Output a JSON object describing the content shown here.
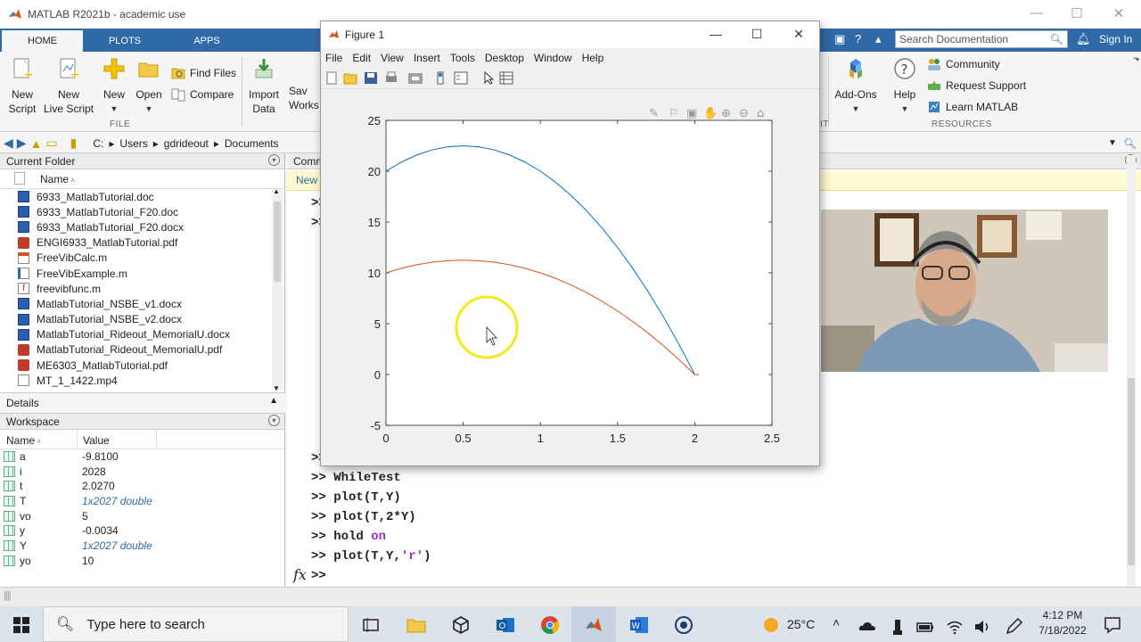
{
  "window": {
    "title": "MATLAB R2021b - academic use",
    "controls": [
      "—",
      "☐",
      "✕"
    ]
  },
  "tabs": [
    "HOME",
    "PLOTS",
    "APPS"
  ],
  "search": {
    "placeholder": "Search Documentation"
  },
  "signin": "Sign In",
  "ribbon": {
    "file": {
      "new_script": [
        "New",
        "Script"
      ],
      "new_live_script": [
        "New",
        "Live Script"
      ],
      "new": "New",
      "open": "Open",
      "find_files": "Find Files",
      "compare": "Compare",
      "label": "FILE"
    },
    "import_data": [
      "Import",
      "Data"
    ],
    "save_workspace": [
      "Sav",
      "Works"
    ],
    "add_ons": "Add-Ons",
    "help": "Help",
    "community": "Community",
    "request_support": "Request Support",
    "learn_matlab": "Learn MATLAB",
    "resources_label": "RESOURCES",
    "env_label_fragment": "IT"
  },
  "address": [
    "C:",
    "Users",
    "gdrideout",
    "Documents"
  ],
  "current_folder": {
    "title": "Current Folder",
    "column": "Name",
    "files": [
      {
        "name": "6933_MatlabTutorial.doc",
        "type": "word"
      },
      {
        "name": "6933_MatlabTutorial_F20.doc",
        "type": "word"
      },
      {
        "name": "6933_MatlabTutorial_F20.docx",
        "type": "word"
      },
      {
        "name": "ENGI6933_MatlabTutorial.pdf",
        "type": "pdf"
      },
      {
        "name": "FreeVibCalc.m",
        "type": "live"
      },
      {
        "name": "FreeVibExample.m",
        "type": "script"
      },
      {
        "name": "freevibfunc.m",
        "type": "func"
      },
      {
        "name": "MatlabTutorial_NSBE_v1.docx",
        "type": "word"
      },
      {
        "name": "MatlabTutorial_NSBE_v2.docx",
        "type": "word"
      },
      {
        "name": "MatlabTutorial_Rideout_MemorialU.docx",
        "type": "word"
      },
      {
        "name": "MatlabTutorial_Rideout_MemorialU.pdf",
        "type": "pdf"
      },
      {
        "name": "ME6303_MatlabTutorial.pdf",
        "type": "pdf"
      },
      {
        "name": "MT_1_1422.mp4",
        "type": "video"
      }
    ]
  },
  "details": {
    "title": "Details"
  },
  "workspace": {
    "title": "Workspace",
    "col_name": "Name",
    "col_value": "Value",
    "vars": [
      {
        "name": "a",
        "value": "-9.8100",
        "italic": false
      },
      {
        "name": "i",
        "value": "2028",
        "italic": false
      },
      {
        "name": "t",
        "value": "2.0270",
        "italic": false
      },
      {
        "name": "T",
        "value": "1x2027 double",
        "italic": true
      },
      {
        "name": "vo",
        "value": "5",
        "italic": false
      },
      {
        "name": "y",
        "value": "-0.0034",
        "italic": false
      },
      {
        "name": "Y",
        "value": "1x2027 double",
        "italic": true
      },
      {
        "name": "yo",
        "value": "10",
        "italic": false
      }
    ]
  },
  "command_window": {
    "title": "Comm",
    "new_link": "New",
    "prompt": ">>",
    "fx": "fx",
    "lines": [
      {
        "prompt": ">>",
        "text": "WhileTest"
      },
      {
        "prompt": ">>",
        "text": "plot(T,Y)"
      },
      {
        "prompt": ">>",
        "text": "plot(T,2*Y)"
      },
      {
        "prompt": ">>",
        "pre": "hold ",
        "kw": "on"
      },
      {
        "prompt": ">>",
        "pre": "plot(T,Y,",
        "str": "'r'",
        "post": ")"
      }
    ]
  },
  "figure": {
    "title": "Figure 1",
    "menu": [
      "File",
      "Edit",
      "View",
      "Insert",
      "Tools",
      "Desktop",
      "Window",
      "Help"
    ]
  },
  "chart_data": {
    "type": "line",
    "title": "",
    "xlabel": "",
    "ylabel": "",
    "xlim": [
      0,
      2.5
    ],
    "ylim": [
      -5,
      25
    ],
    "xticks": [
      "0",
      "0.5",
      "1",
      "1.5",
      "2",
      "2.5"
    ],
    "yticks": [
      "-5",
      "0",
      "5",
      "10",
      "15",
      "20",
      "25"
    ],
    "grid": false,
    "series": [
      {
        "color": "#0072bd",
        "x": [
          0,
          0.1,
          0.2,
          0.3,
          0.4,
          0.5,
          0.6,
          0.7,
          0.8,
          0.9,
          1.0,
          1.1,
          1.2,
          1.3,
          1.4,
          1.5,
          1.6,
          1.7,
          1.8,
          1.9,
          2.0,
          2.027
        ],
        "y": [
          20,
          20.9,
          21.6,
          22.1,
          22.4,
          22.5,
          22.4,
          22.1,
          21.6,
          20.9,
          20.0,
          18.9,
          17.6,
          16.1,
          14.4,
          12.5,
          10.4,
          8.1,
          5.6,
          2.9,
          0.0,
          -0.0068
        ]
      },
      {
        "color": "#d95319",
        "x": [
          0,
          0.1,
          0.2,
          0.3,
          0.4,
          0.5,
          0.6,
          0.7,
          0.8,
          0.9,
          1.0,
          1.1,
          1.2,
          1.3,
          1.4,
          1.5,
          1.6,
          1.7,
          1.8,
          1.9,
          2.0,
          2.027
        ],
        "y": [
          10,
          10.45,
          10.8,
          11.05,
          11.2,
          11.25,
          11.2,
          11.05,
          10.8,
          10.45,
          10.0,
          9.45,
          8.8,
          8.05,
          7.2,
          6.25,
          5.2,
          4.05,
          2.8,
          1.45,
          0.0,
          -0.0034
        ]
      }
    ]
  },
  "taskbar": {
    "search_placeholder": "Type here to search",
    "weather": "25°C",
    "time": "4:12 PM",
    "date": "7/18/2022"
  }
}
